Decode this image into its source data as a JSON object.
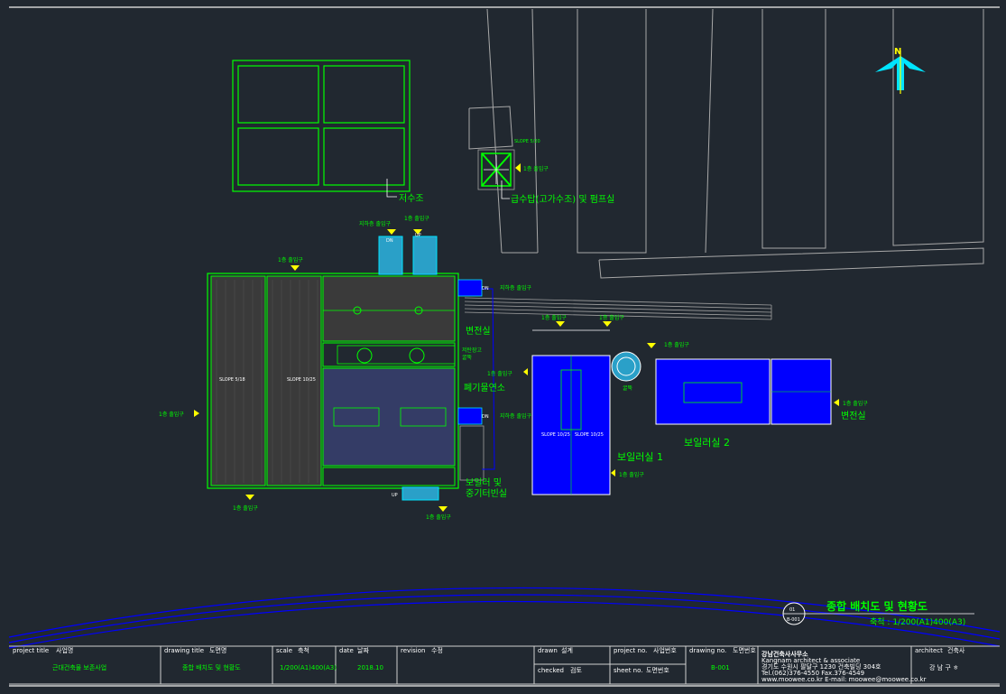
{
  "colors": {
    "background": "#212830",
    "line_white": "#c8c8c8",
    "green": "#00ff00",
    "blue": "#0000ff",
    "yellow": "#ffff00",
    "cyan": "#00e5ff"
  },
  "labels": {
    "north": "N",
    "reservoir": "저수조",
    "water_tower": "급수탑(고가수조) 및 펌프실",
    "slope_tower": "SLOPE 5/20",
    "exit1": "1층 출입구",
    "basement_exit": "지하층 출입구",
    "basement_exit_b": "지하층 출입구",
    "electrical_room_1": "변전실",
    "electrical_room_2": "변전실",
    "fuel_storage": "저탄장고",
    "chimney": "굴뚝",
    "incineration": "폐기물연소",
    "boiler_room_1": "보일러실 1",
    "boiler_room_2": "보일러실 2",
    "boiler_smoke": [
      "보일러 및",
      "중기터빈실"
    ],
    "up": "UP",
    "dn": "DN",
    "slope_5_18": "SLOPE 5/18",
    "slope_10_25": "SLOPE 10/25",
    "slope_5_25": "SLOPE 5/25",
    "slope_10_25b": "SLOPE 10/25",
    "slope_10_25c": "SLOPE 10/25"
  },
  "drawing_title": "종합 배치도 및 현황도",
  "drawing_scale": "축척 : 1/200(A1)400(A3)",
  "section_marker": {
    "top": "01",
    "bottom": "B-001"
  },
  "title_block": {
    "project_title_label": "project title",
    "project_title_label_ko": "사업명",
    "project_title": "근대건축물 보존사업",
    "drawing_title_label": "drawing title",
    "drawing_title_label_ko": "도면명",
    "drawing_title": "종합 배치도 및 현황도",
    "scale_label": "scale",
    "scale_label_ko": "축척",
    "scale": "1/200(A1)400(A3)",
    "date_label": "date",
    "date_label_ko": "날짜",
    "date": "2018.10",
    "revision_label": "revision",
    "revision_label_ko": "수정",
    "drawn_label": "drawn",
    "drawn_label_ko": "설계",
    "checked_label": "checked",
    "checked_label_ko": "검토",
    "project_no_label": "project no.",
    "project_no_label_ko": "사업번호",
    "sheet_no_label": "sheet no.",
    "sheet_no_label_ko": "도면번호",
    "drawing_no_label": "drawing no.",
    "drawing_no_label_ko": "도면번호",
    "drawing_no": "B-001",
    "firm_name": "강남건축사사무소",
    "firm_name_en": "Kangnam architect & associate",
    "firm_address": "경기도 수원시 팔달구 1230 건축빌딩 304호",
    "firm_tel": "Tel.(062)376-4550  Fax.376-4549",
    "firm_web": "www.moowee.co.kr  E-mail: moowee@moowee.co.kr",
    "architect_label": "architect",
    "architect_label_ko": "건축사",
    "architect": "강 남 구 ㅎ"
  }
}
